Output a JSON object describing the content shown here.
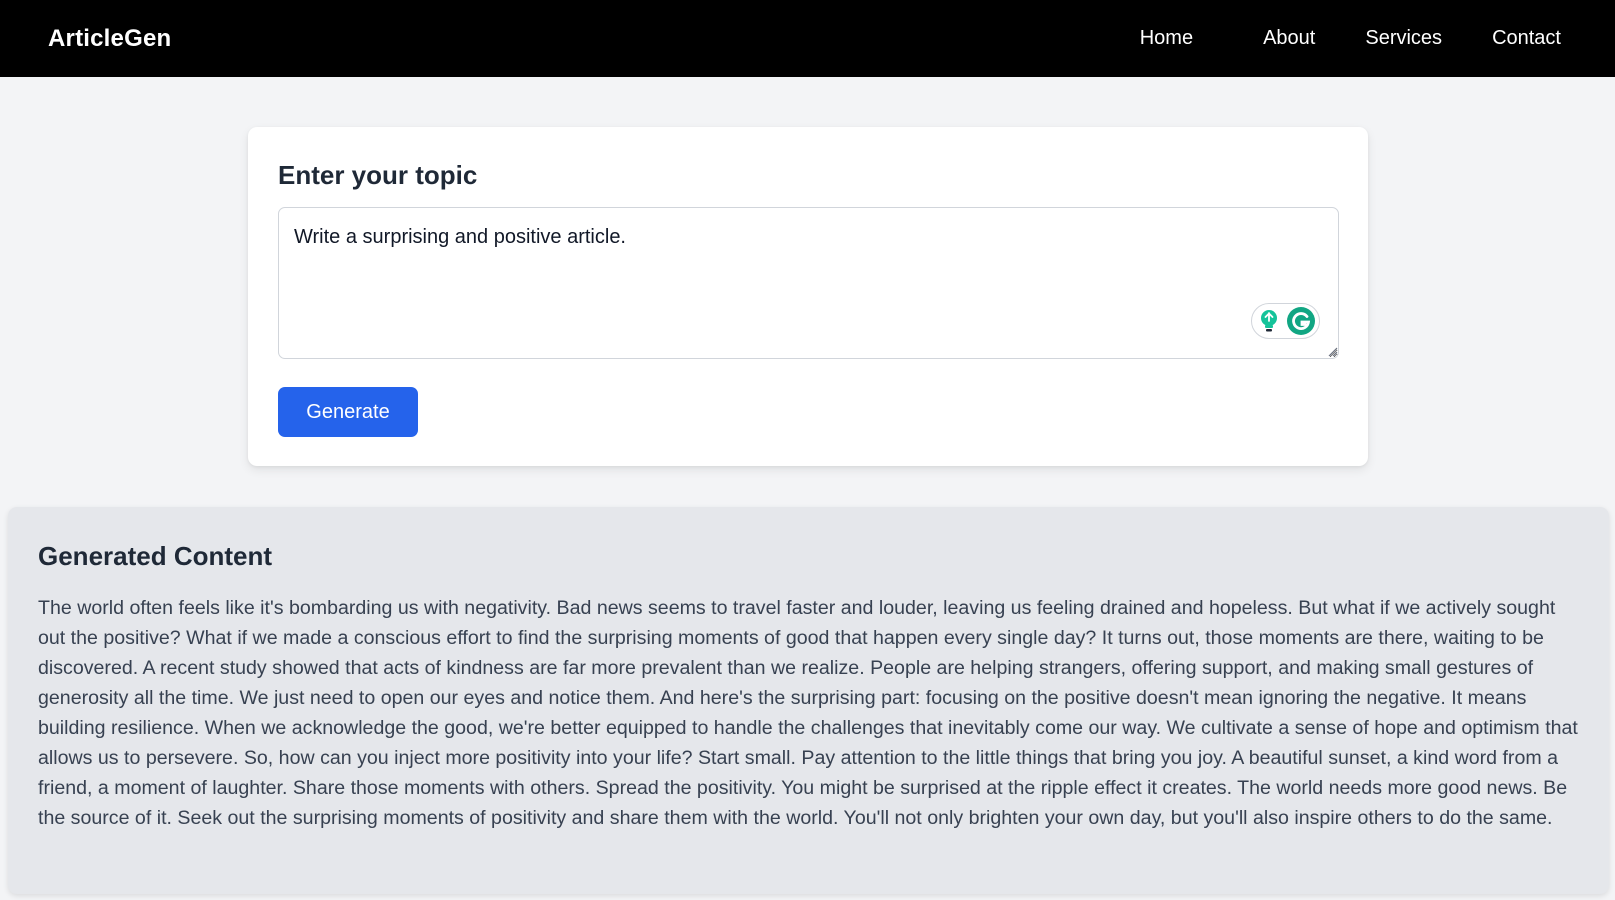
{
  "app": {
    "brand": "ArticleGen"
  },
  "nav": {
    "home": "Home",
    "about": "About",
    "services": "Services",
    "contact": "Contact"
  },
  "topic_form": {
    "heading": "Enter your topic",
    "input_value": "Write a surprising and positive article.",
    "generate_label": "Generate",
    "extension_icons": [
      "lightbulb-icon",
      "grammarly-icon"
    ]
  },
  "output": {
    "heading": "Generated Content",
    "body": "The world often feels like it's bombarding us with negativity. Bad news seems to travel faster and louder, leaving us feeling drained and hopeless. But what if we actively sought out the positive? What if we made a conscious effort to find the surprising moments of good that happen every single day? It turns out, those moments are there, waiting to be discovered. A recent study showed that acts of kindness are far more prevalent than we realize. People are helping strangers, offering support, and making small gestures of generosity all the time. We just need to open our eyes and notice them. And here's the surprising part: focusing on the positive doesn't mean ignoring the negative. It means building resilience. When we acknowledge the good, we're better equipped to handle the challenges that inevitably come our way. We cultivate a sense of hope and optimism that allows us to persevere. So, how can you inject more positivity into your life? Start small. Pay attention to the little things that bring you joy. A beautiful sunset, a kind word from a friend, a moment of laughter. Share those moments with others. Spread the positivity. You might be surprised at the ripple effect it creates. The world needs more good news. Be the source of it. Seek out the surprising moments of positivity and share them with the world. You'll not only brighten your own day, but you'll also inspire others to do the same."
  },
  "colors": {
    "navbar_bg": "#000000",
    "page_bg": "#f3f4f6",
    "card_bg": "#ffffff",
    "primary_button": "#2563eb",
    "output_bg": "#e5e7eb",
    "grammarly_green": "#15c39a"
  }
}
